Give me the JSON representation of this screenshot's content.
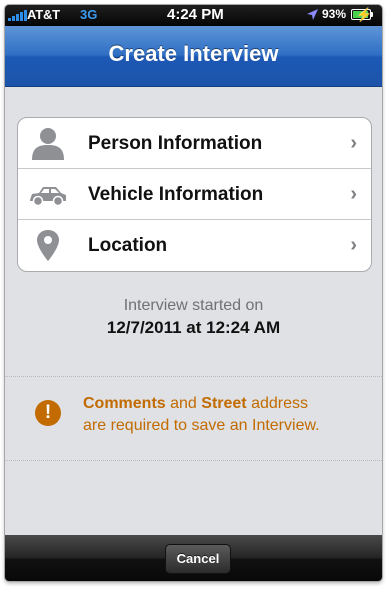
{
  "status_bar": {
    "carrier": "AT&T",
    "network": "3G",
    "time": "4:24 PM",
    "battery_percent": "93%",
    "battery_level": 0.93
  },
  "nav": {
    "title": "Create Interview"
  },
  "menu": {
    "items": [
      {
        "label": "Person Information",
        "icon": "person-icon"
      },
      {
        "label": "Vehicle Information",
        "icon": "car-icon"
      },
      {
        "label": "Location",
        "icon": "map-pin-icon"
      }
    ]
  },
  "interview": {
    "started_label": "Interview started on",
    "started_value": "12/7/2011 at 12:24 AM"
  },
  "warning": {
    "word1": "Comments",
    "text1": " and ",
    "word2": "Street",
    "text2": " address",
    "line2": "are required to save an Interview."
  },
  "toolbar": {
    "cancel_label": "Cancel"
  },
  "colors": {
    "nav_blue": "#2f6fc4",
    "warning": "#c26b00",
    "signal": "#2f8ee9",
    "battery": "#4bd14d"
  }
}
